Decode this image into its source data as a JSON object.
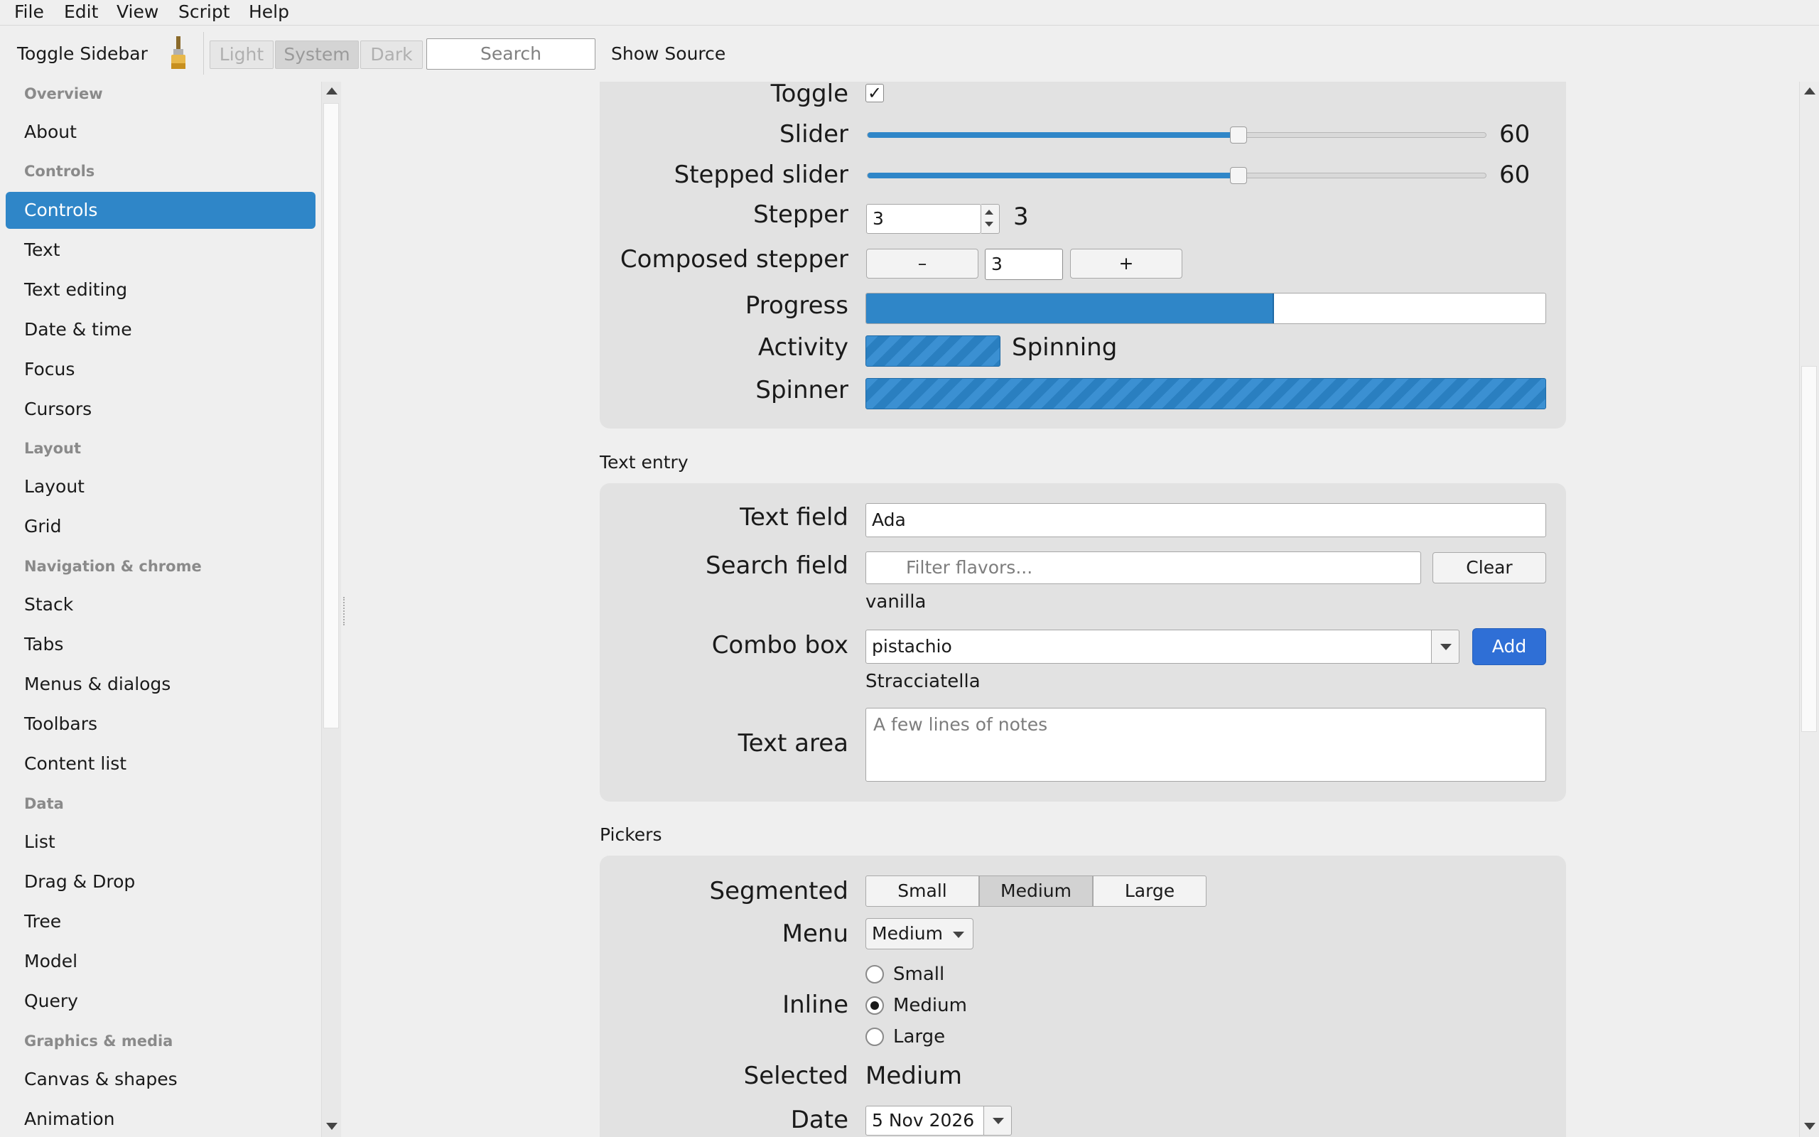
{
  "menu": [
    "File",
    "Edit",
    "View",
    "Script",
    "Help"
  ],
  "toolbar": {
    "toggle_sidebar": "Toggle Sidebar",
    "theme_buttons": [
      "Light",
      "System",
      "Dark"
    ],
    "search_placeholder": "Search",
    "show_source": "Show Source",
    "brush_icon": "paintbrush-icon"
  },
  "sidebar": {
    "sections": [
      {
        "header": "Overview",
        "items": [
          "About"
        ]
      },
      {
        "header": "Controls",
        "items": [
          "Controls",
          "Text",
          "Text editing",
          "Date & time",
          "Focus",
          "Cursors"
        ]
      },
      {
        "header": "Layout",
        "items": [
          "Layout",
          "Grid"
        ]
      },
      {
        "header": "Navigation & chrome",
        "items": [
          "Stack",
          "Tabs",
          "Menus & dialogs",
          "Toolbars",
          "Content list"
        ]
      },
      {
        "header": "Data",
        "items": [
          "List",
          "Drag & Drop",
          "Tree",
          "Model",
          "Query"
        ]
      },
      {
        "header": "Graphics & media",
        "items": [
          "Canvas & shapes",
          "Animation"
        ]
      }
    ],
    "selected": "Controls"
  },
  "controls_group": {
    "toggle": {
      "label": "Toggle",
      "checked": true
    },
    "slider": {
      "label": "Slider",
      "value": "60",
      "fraction": 0.6
    },
    "stepped_slider": {
      "label": "Stepped slider",
      "value": "60",
      "fraction": 0.6
    },
    "stepper": {
      "label": "Stepper",
      "field": "3",
      "value": "3"
    },
    "composed_stepper": {
      "label": "Composed stepper",
      "minus": "–",
      "field": "3",
      "plus": "+"
    },
    "progress": {
      "label": "Progress",
      "fraction": 0.6
    },
    "activity": {
      "label": "Activity",
      "status": "Spinning"
    },
    "spinner": {
      "label": "Spinner"
    }
  },
  "text_entry": {
    "title": "Text entry",
    "text_field": {
      "label": "Text field",
      "value": "Ada"
    },
    "search_field": {
      "label": "Search field",
      "placeholder": "Filter flavors...",
      "clear": "Clear",
      "result": "vanilla"
    },
    "combo_box": {
      "label": "Combo box",
      "value": "pistachio",
      "add": "Add",
      "result": "Stracciatella"
    },
    "text_area": {
      "label": "Text area",
      "placeholder": "A few lines of notes"
    }
  },
  "pickers": {
    "title": "Pickers",
    "segmented": {
      "label": "Segmented",
      "options": [
        "Small",
        "Medium",
        "Large"
      ],
      "selected": "Medium"
    },
    "menu": {
      "label": "Menu",
      "value": "Medium"
    },
    "inline": {
      "label": "Inline",
      "options": [
        "Small",
        "Medium",
        "Large"
      ],
      "selected": "Medium"
    },
    "selected": {
      "label": "Selected",
      "value": "Medium"
    },
    "date": {
      "label": "Date",
      "value": "5 Nov 2026"
    }
  },
  "colors": {
    "accent": "#2f86c8",
    "add_button": "#2f6fd6"
  }
}
